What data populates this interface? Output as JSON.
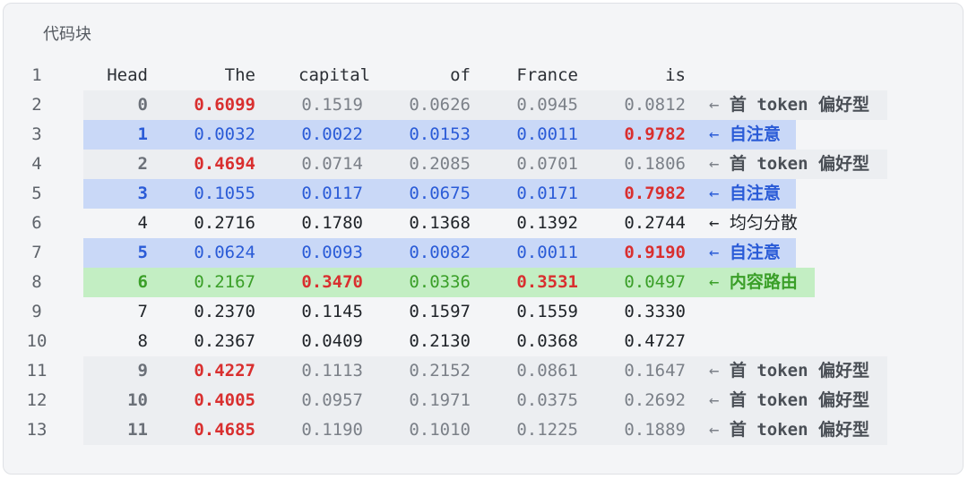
{
  "title": "代码块",
  "colors": {
    "attention_row_bg": "#c9d8f7",
    "routing_row_bg": "#c3eec3",
    "first_token_row_bg": "#eceef1",
    "highlight_text": "#d92f2f",
    "blue_text": "#2a5bd7",
    "green_text": "#3a9f28"
  },
  "lines": [
    {
      "num": "1",
      "cells": [
        "Head",
        "The",
        "capital",
        "of",
        "France",
        "is"
      ],
      "arrow": "",
      "note": "",
      "kind": "header",
      "hl": []
    },
    {
      "num": "2",
      "cells": [
        "0",
        "0.6099",
        "0.1519",
        "0.0626",
        "0.0945",
        "0.0812"
      ],
      "arrow": "←",
      "note": "首 token 偏好型",
      "kind": "first",
      "hl": [
        1
      ]
    },
    {
      "num": "3",
      "cells": [
        "1",
        "0.0032",
        "0.0022",
        "0.0153",
        "0.0011",
        "0.9782"
      ],
      "arrow": "←",
      "note": "自注意",
      "kind": "self",
      "hl": [
        5
      ]
    },
    {
      "num": "4",
      "cells": [
        "2",
        "0.4694",
        "0.0714",
        "0.2085",
        "0.0701",
        "0.1806"
      ],
      "arrow": "←",
      "note": "首 token 偏好型",
      "kind": "first",
      "hl": [
        1
      ]
    },
    {
      "num": "5",
      "cells": [
        "3",
        "0.1055",
        "0.0117",
        "0.0675",
        "0.0171",
        "0.7982"
      ],
      "arrow": "←",
      "note": "自注意",
      "kind": "self",
      "hl": [
        5
      ]
    },
    {
      "num": "6",
      "cells": [
        "4",
        "0.2716",
        "0.1780",
        "0.1368",
        "0.1392",
        "0.2744"
      ],
      "arrow": "←",
      "note": "均匀分散",
      "kind": "uniform",
      "hl": []
    },
    {
      "num": "7",
      "cells": [
        "5",
        "0.0624",
        "0.0093",
        "0.0082",
        "0.0011",
        "0.9190"
      ],
      "arrow": "←",
      "note": "自注意",
      "kind": "self",
      "hl": [
        5
      ]
    },
    {
      "num": "8",
      "cells": [
        "6",
        "0.2167",
        "0.3470",
        "0.0336",
        "0.3531",
        "0.0497"
      ],
      "arrow": "←",
      "note": "内容路由",
      "kind": "route",
      "hl": [
        2,
        4
      ]
    },
    {
      "num": "9",
      "cells": [
        "7",
        "0.2370",
        "0.1145",
        "0.1597",
        "0.1559",
        "0.3330"
      ],
      "arrow": "",
      "note": "",
      "kind": "plain",
      "hl": []
    },
    {
      "num": "10",
      "cells": [
        "8",
        "0.2367",
        "0.0409",
        "0.2130",
        "0.0368",
        "0.4727"
      ],
      "arrow": "",
      "note": "",
      "kind": "plain",
      "hl": []
    },
    {
      "num": "11",
      "cells": [
        "9",
        "0.4227",
        "0.1113",
        "0.2152",
        "0.0861",
        "0.1647"
      ],
      "arrow": "←",
      "note": "首 token 偏好型",
      "kind": "first",
      "hl": [
        1
      ]
    },
    {
      "num": "12",
      "cells": [
        "10",
        "0.4005",
        "0.0957",
        "0.1971",
        "0.0375",
        "0.2692"
      ],
      "arrow": "←",
      "note": "首 token 偏好型",
      "kind": "first",
      "hl": [
        1
      ]
    },
    {
      "num": "13",
      "cells": [
        "11",
        "0.4685",
        "0.1190",
        "0.1010",
        "0.1225",
        "0.1889"
      ],
      "arrow": "←",
      "note": "首 token 偏好型",
      "kind": "first",
      "hl": [
        1
      ]
    }
  ]
}
